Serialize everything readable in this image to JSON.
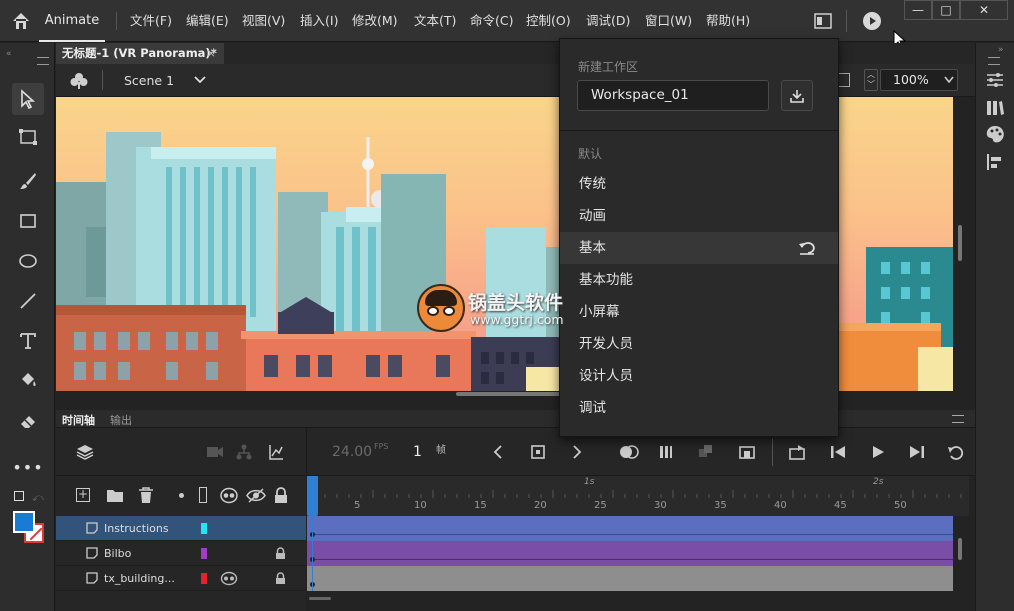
{
  "app": {
    "name": "Animate"
  },
  "menu": [
    "文件(F)",
    "编辑(E)",
    "视图(V)",
    "插入(I)",
    "修改(M)",
    "文本(T)",
    "命令(C)",
    "控制(O)",
    "调试(D)",
    "窗口(W)",
    "帮助(H)"
  ],
  "document": {
    "tab_title": "无标题-1 (VR Panorama)*",
    "close": "×",
    "scene": "Scene 1",
    "zoom": "100%"
  },
  "watermark": {
    "line1": "锅盖头软件",
    "line2": "www.ggtrj.com"
  },
  "timeline": {
    "tabs": [
      "时间轴",
      "输出"
    ],
    "fps_value": "24.00",
    "fps_unit": "FPS",
    "frame_value": "1",
    "frame_unit": "帧",
    "ruler_ticks": [
      "5",
      "10",
      "15",
      "20",
      "25",
      "30",
      "35",
      "40",
      "45",
      "50"
    ],
    "ruler_seconds": [
      "1s",
      "2s"
    ],
    "layers": [
      {
        "name": "Instructions",
        "color": "#22e6f0",
        "selected": true
      },
      {
        "name": "Bilbo",
        "color": "#a33cc8",
        "selected": false
      },
      {
        "name": "tx_building...",
        "color": "#e8202a",
        "selected": false
      }
    ]
  },
  "workspace_menu": {
    "new_label": "新建工作区",
    "input_value": "Workspace_01",
    "section_label": "默认",
    "items": [
      "传统",
      "动画",
      "基本",
      "基本功能",
      "小屏幕",
      "开发人员",
      "设计人员",
      "调试"
    ],
    "highlighted": "基本"
  },
  "colors": {
    "stroke": "#1a7ad4",
    "fill": "#d93a3a",
    "accent": "#1a73e8"
  }
}
